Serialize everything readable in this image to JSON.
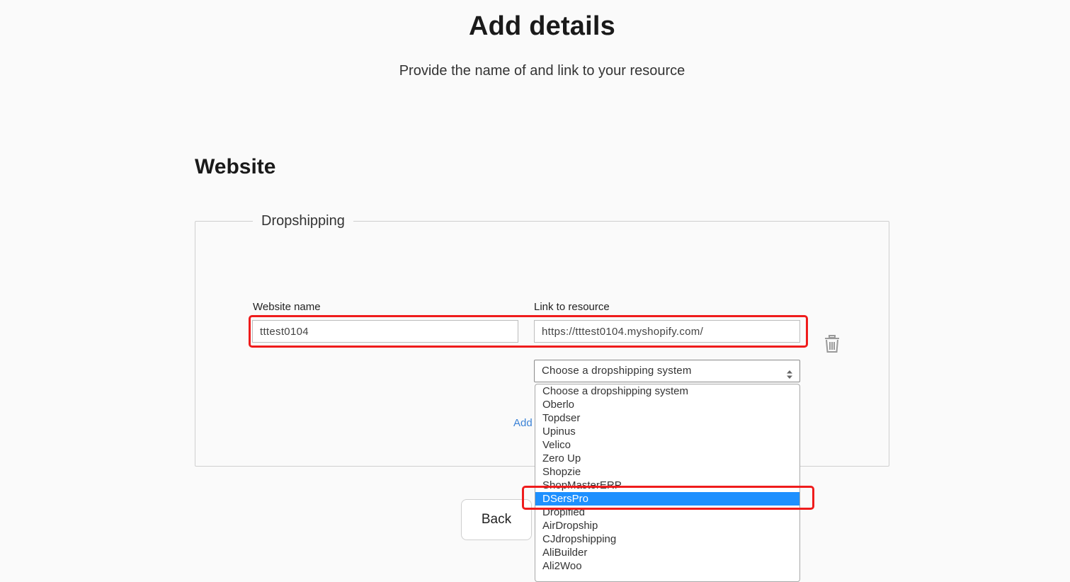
{
  "header": {
    "title": "Add details",
    "subtitle": "Provide the name of and link to your resource"
  },
  "section": {
    "title": "Website",
    "legend": "Dropshipping"
  },
  "form": {
    "website_name_label": "Website name",
    "website_name_value": "tttest0104",
    "link_label": "Link to resource",
    "link_value": "https://tttest0104.myshopify.com/",
    "system_select_value": "Choose a dropshipping system",
    "add_link_label": "Add"
  },
  "dropdown": {
    "options": [
      "Choose a dropshipping system",
      "Oberlo",
      "Topdser",
      "Upinus",
      "Velico",
      "Zero Up",
      "Shopzie",
      "ShopMasterERP",
      "DSersPro",
      "Dropified",
      "AirDropship",
      "CJdropshipping",
      "AliBuilder",
      "Ali2Woo"
    ],
    "highlighted": "DSersPro"
  },
  "actions": {
    "back_label": "Back"
  },
  "icons": {
    "trash": "trash-icon",
    "select_arrows": "up-down-arrows-icon"
  },
  "colors": {
    "highlight": "#1e90ff",
    "annotation": "#ef1c1c",
    "link": "#3b82d6"
  }
}
